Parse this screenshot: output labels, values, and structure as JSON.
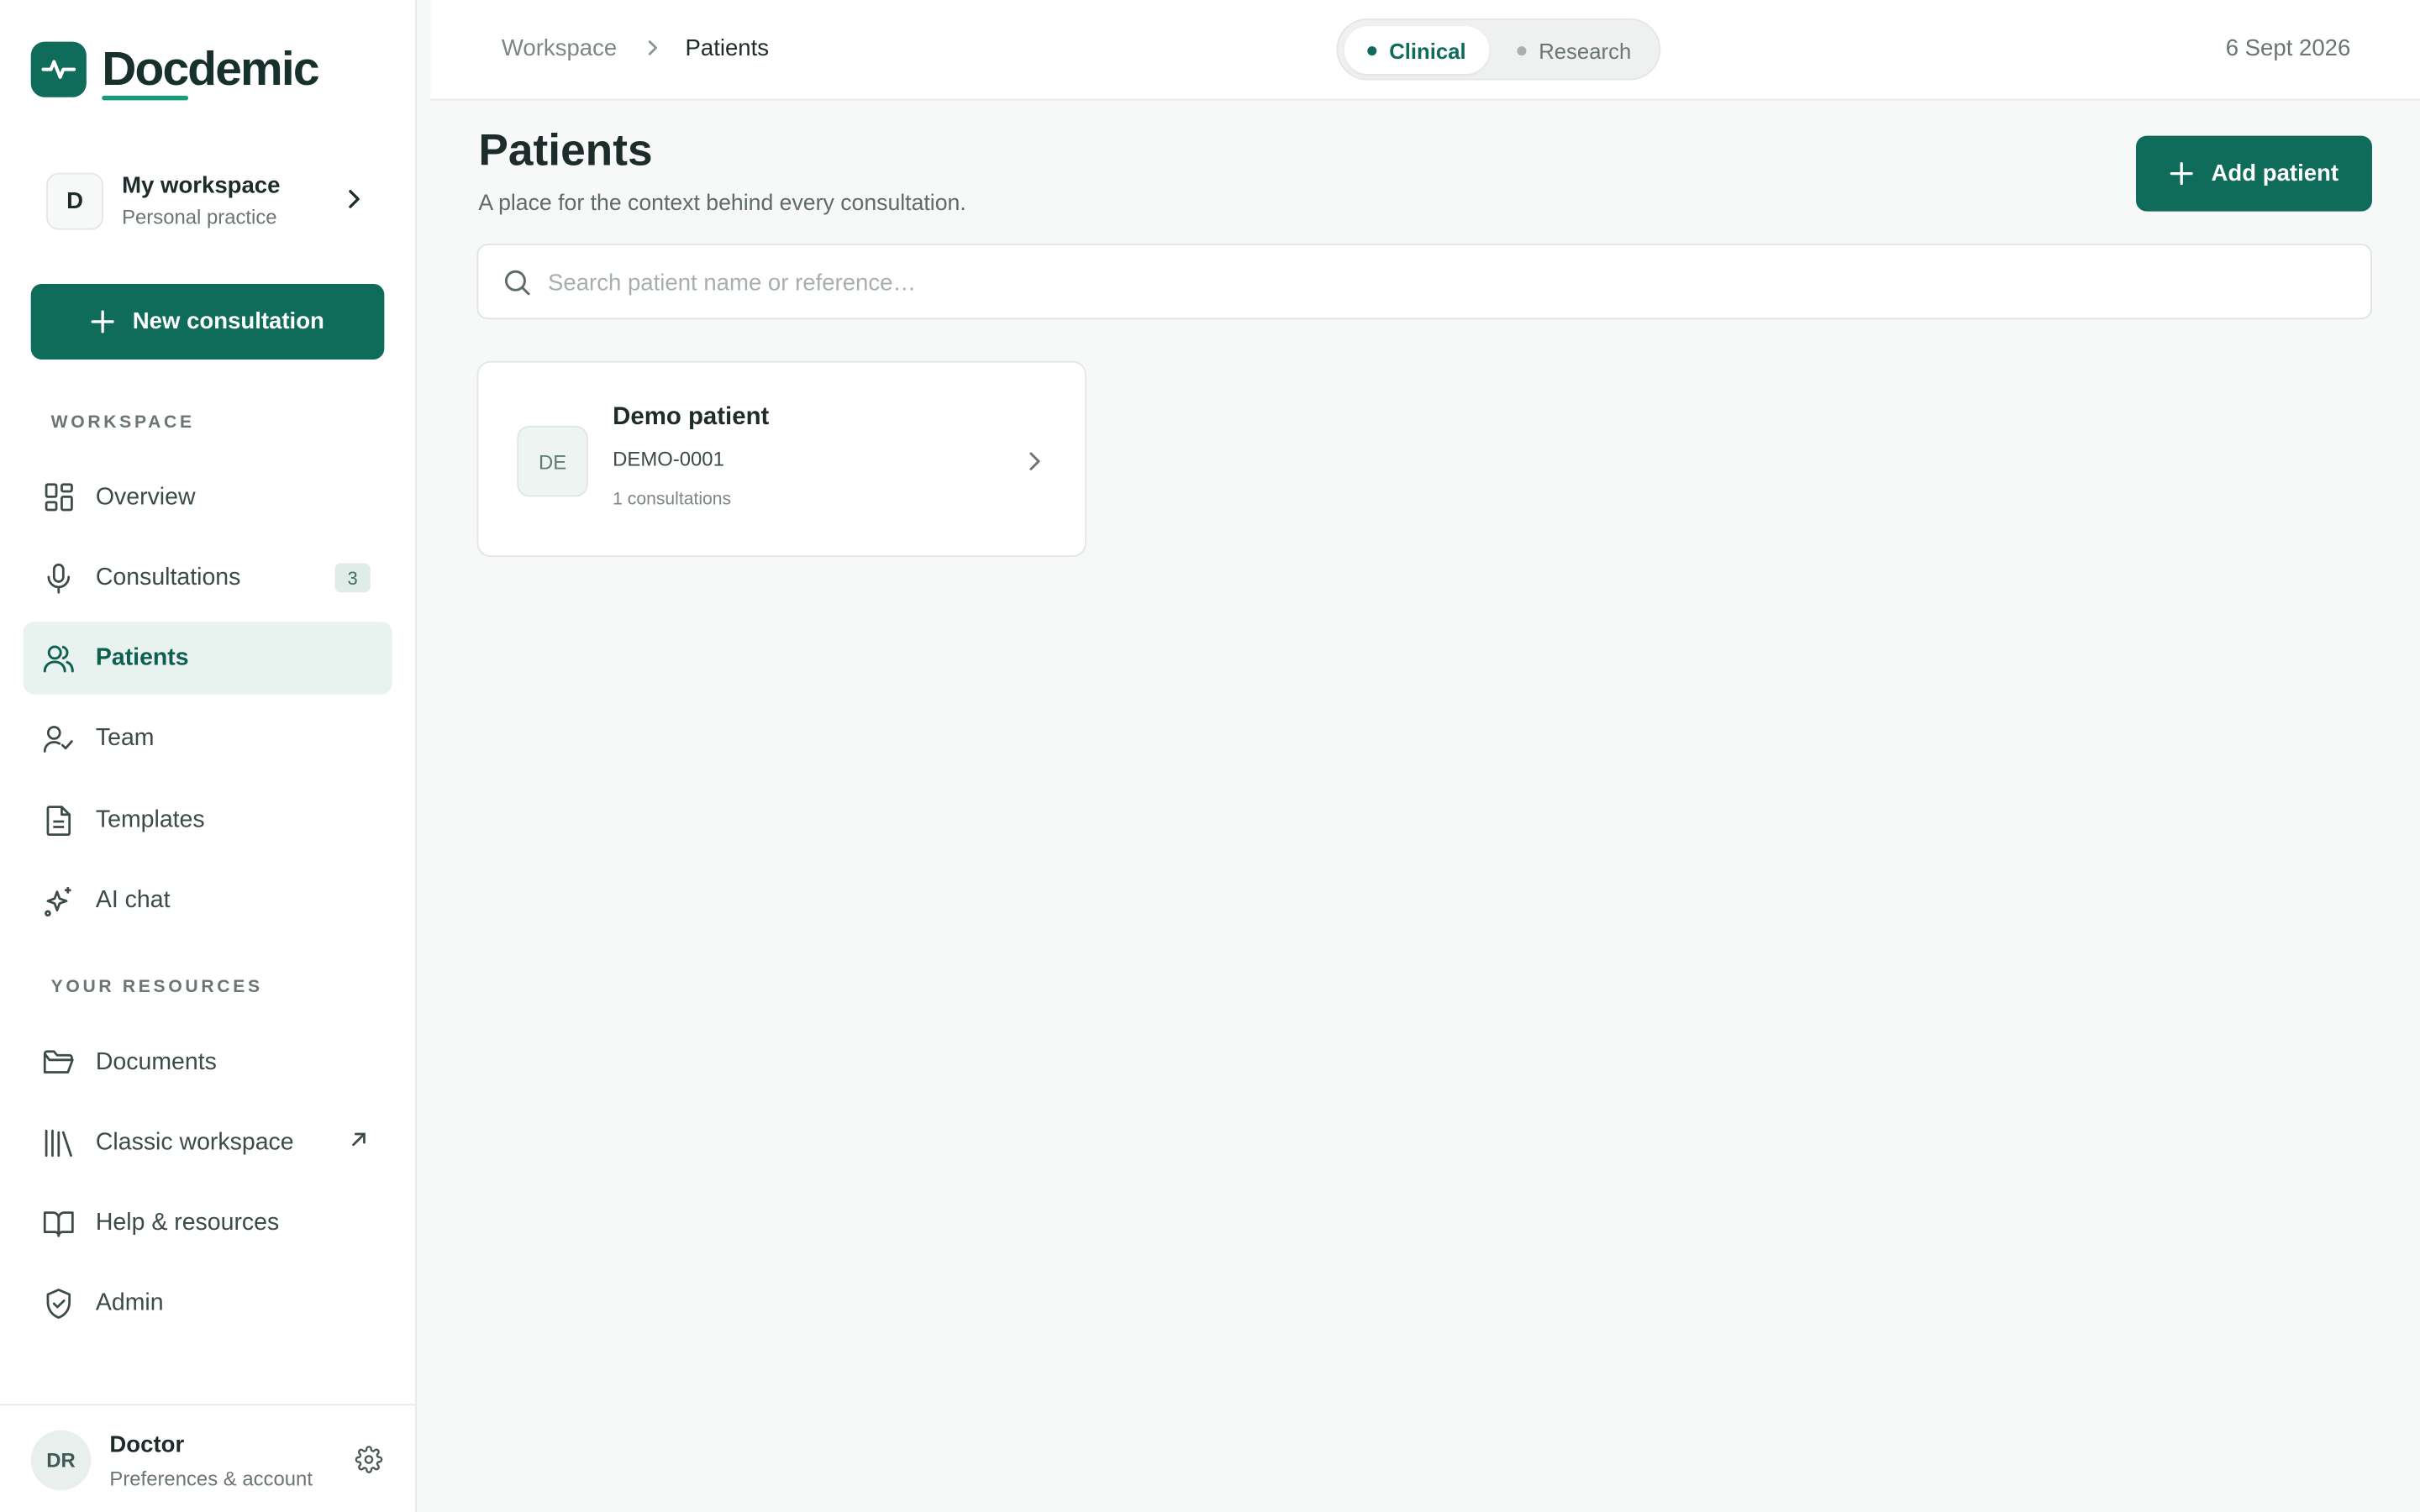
{
  "brand": {
    "name": "Docdemic"
  },
  "workspace": {
    "initial": "D",
    "name": "My workspace",
    "subtitle": "Personal practice"
  },
  "sidebar": {
    "new_consultation_label": "New consultation",
    "section_workspace": "WORKSPACE",
    "section_resources": "YOUR RESOURCES",
    "items": [
      {
        "label": "Overview",
        "icon": "grid-icon"
      },
      {
        "label": "Consultations",
        "icon": "microphone-icon",
        "badge": "3"
      },
      {
        "label": "Patients",
        "icon": "users-icon",
        "active": true
      },
      {
        "label": "Team",
        "icon": "user-check-icon"
      },
      {
        "label": "Templates",
        "icon": "document-icon"
      },
      {
        "label": "AI chat",
        "icon": "sparkles-icon"
      }
    ],
    "resources": [
      {
        "label": "Documents",
        "icon": "folder-icon"
      },
      {
        "label": "Classic workspace",
        "icon": "library-icon",
        "external": true
      },
      {
        "label": "Help & resources",
        "icon": "book-icon"
      },
      {
        "label": "Admin",
        "icon": "shield-icon"
      }
    ]
  },
  "user": {
    "initials": "DR",
    "name": "Doctor",
    "subtitle": "Preferences & account"
  },
  "topbar": {
    "breadcrumb": [
      "Workspace",
      "Patients"
    ],
    "modes": [
      {
        "label": "Clinical",
        "selected": true
      },
      {
        "label": "Research",
        "selected": false
      }
    ],
    "date": "6 Sept 2026"
  },
  "main": {
    "title": "Patients",
    "subtitle": "A place for the context behind every consultation.",
    "add_button_label": "Add patient",
    "search_placeholder": "Search patient name or reference…",
    "patients": [
      {
        "initials": "DE",
        "name": "Demo patient",
        "reference": "DEMO-0001",
        "consultations": "1 consultations"
      }
    ]
  },
  "colors": {
    "accent": "#0f6b5a",
    "active_bg": "#e8f2ee"
  }
}
